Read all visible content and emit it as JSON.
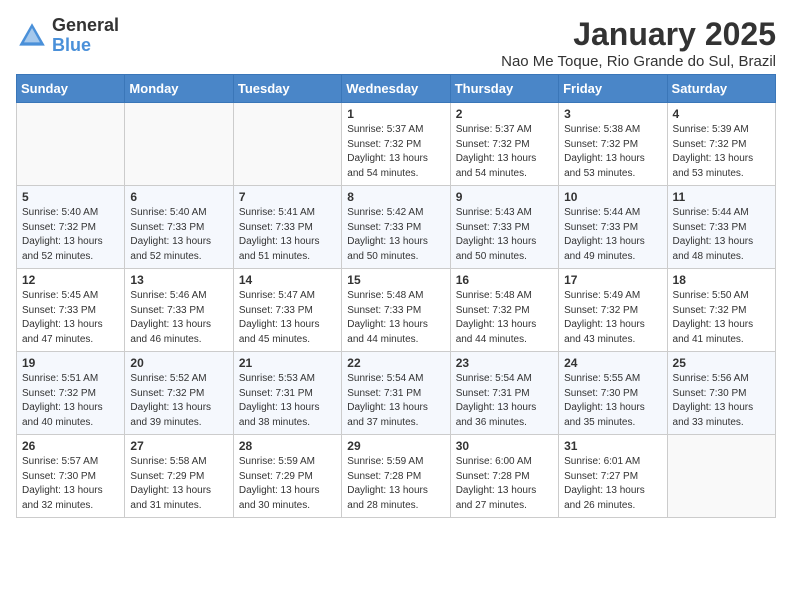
{
  "header": {
    "logo_general": "General",
    "logo_blue": "Blue",
    "month_title": "January 2025",
    "location": "Nao Me Toque, Rio Grande do Sul, Brazil"
  },
  "days_of_week": [
    "Sunday",
    "Monday",
    "Tuesday",
    "Wednesday",
    "Thursday",
    "Friday",
    "Saturday"
  ],
  "weeks": [
    [
      {
        "day": "",
        "sunrise": "",
        "sunset": "",
        "daylight": ""
      },
      {
        "day": "",
        "sunrise": "",
        "sunset": "",
        "daylight": ""
      },
      {
        "day": "",
        "sunrise": "",
        "sunset": "",
        "daylight": ""
      },
      {
        "day": "1",
        "sunrise": "Sunrise: 5:37 AM",
        "sunset": "Sunset: 7:32 PM",
        "daylight": "Daylight: 13 hours and 54 minutes."
      },
      {
        "day": "2",
        "sunrise": "Sunrise: 5:37 AM",
        "sunset": "Sunset: 7:32 PM",
        "daylight": "Daylight: 13 hours and 54 minutes."
      },
      {
        "day": "3",
        "sunrise": "Sunrise: 5:38 AM",
        "sunset": "Sunset: 7:32 PM",
        "daylight": "Daylight: 13 hours and 53 minutes."
      },
      {
        "day": "4",
        "sunrise": "Sunrise: 5:39 AM",
        "sunset": "Sunset: 7:32 PM",
        "daylight": "Daylight: 13 hours and 53 minutes."
      }
    ],
    [
      {
        "day": "5",
        "sunrise": "Sunrise: 5:40 AM",
        "sunset": "Sunset: 7:32 PM",
        "daylight": "Daylight: 13 hours and 52 minutes."
      },
      {
        "day": "6",
        "sunrise": "Sunrise: 5:40 AM",
        "sunset": "Sunset: 7:33 PM",
        "daylight": "Daylight: 13 hours and 52 minutes."
      },
      {
        "day": "7",
        "sunrise": "Sunrise: 5:41 AM",
        "sunset": "Sunset: 7:33 PM",
        "daylight": "Daylight: 13 hours and 51 minutes."
      },
      {
        "day": "8",
        "sunrise": "Sunrise: 5:42 AM",
        "sunset": "Sunset: 7:33 PM",
        "daylight": "Daylight: 13 hours and 50 minutes."
      },
      {
        "day": "9",
        "sunrise": "Sunrise: 5:43 AM",
        "sunset": "Sunset: 7:33 PM",
        "daylight": "Daylight: 13 hours and 50 minutes."
      },
      {
        "day": "10",
        "sunrise": "Sunrise: 5:44 AM",
        "sunset": "Sunset: 7:33 PM",
        "daylight": "Daylight: 13 hours and 49 minutes."
      },
      {
        "day": "11",
        "sunrise": "Sunrise: 5:44 AM",
        "sunset": "Sunset: 7:33 PM",
        "daylight": "Daylight: 13 hours and 48 minutes."
      }
    ],
    [
      {
        "day": "12",
        "sunrise": "Sunrise: 5:45 AM",
        "sunset": "Sunset: 7:33 PM",
        "daylight": "Daylight: 13 hours and 47 minutes."
      },
      {
        "day": "13",
        "sunrise": "Sunrise: 5:46 AM",
        "sunset": "Sunset: 7:33 PM",
        "daylight": "Daylight: 13 hours and 46 minutes."
      },
      {
        "day": "14",
        "sunrise": "Sunrise: 5:47 AM",
        "sunset": "Sunset: 7:33 PM",
        "daylight": "Daylight: 13 hours and 45 minutes."
      },
      {
        "day": "15",
        "sunrise": "Sunrise: 5:48 AM",
        "sunset": "Sunset: 7:33 PM",
        "daylight": "Daylight: 13 hours and 44 minutes."
      },
      {
        "day": "16",
        "sunrise": "Sunrise: 5:48 AM",
        "sunset": "Sunset: 7:32 PM",
        "daylight": "Daylight: 13 hours and 44 minutes."
      },
      {
        "day": "17",
        "sunrise": "Sunrise: 5:49 AM",
        "sunset": "Sunset: 7:32 PM",
        "daylight": "Daylight: 13 hours and 43 minutes."
      },
      {
        "day": "18",
        "sunrise": "Sunrise: 5:50 AM",
        "sunset": "Sunset: 7:32 PM",
        "daylight": "Daylight: 13 hours and 41 minutes."
      }
    ],
    [
      {
        "day": "19",
        "sunrise": "Sunrise: 5:51 AM",
        "sunset": "Sunset: 7:32 PM",
        "daylight": "Daylight: 13 hours and 40 minutes."
      },
      {
        "day": "20",
        "sunrise": "Sunrise: 5:52 AM",
        "sunset": "Sunset: 7:32 PM",
        "daylight": "Daylight: 13 hours and 39 minutes."
      },
      {
        "day": "21",
        "sunrise": "Sunrise: 5:53 AM",
        "sunset": "Sunset: 7:31 PM",
        "daylight": "Daylight: 13 hours and 38 minutes."
      },
      {
        "day": "22",
        "sunrise": "Sunrise: 5:54 AM",
        "sunset": "Sunset: 7:31 PM",
        "daylight": "Daylight: 13 hours and 37 minutes."
      },
      {
        "day": "23",
        "sunrise": "Sunrise: 5:54 AM",
        "sunset": "Sunset: 7:31 PM",
        "daylight": "Daylight: 13 hours and 36 minutes."
      },
      {
        "day": "24",
        "sunrise": "Sunrise: 5:55 AM",
        "sunset": "Sunset: 7:30 PM",
        "daylight": "Daylight: 13 hours and 35 minutes."
      },
      {
        "day": "25",
        "sunrise": "Sunrise: 5:56 AM",
        "sunset": "Sunset: 7:30 PM",
        "daylight": "Daylight: 13 hours and 33 minutes."
      }
    ],
    [
      {
        "day": "26",
        "sunrise": "Sunrise: 5:57 AM",
        "sunset": "Sunset: 7:30 PM",
        "daylight": "Daylight: 13 hours and 32 minutes."
      },
      {
        "day": "27",
        "sunrise": "Sunrise: 5:58 AM",
        "sunset": "Sunset: 7:29 PM",
        "daylight": "Daylight: 13 hours and 31 minutes."
      },
      {
        "day": "28",
        "sunrise": "Sunrise: 5:59 AM",
        "sunset": "Sunset: 7:29 PM",
        "daylight": "Daylight: 13 hours and 30 minutes."
      },
      {
        "day": "29",
        "sunrise": "Sunrise: 5:59 AM",
        "sunset": "Sunset: 7:28 PM",
        "daylight": "Daylight: 13 hours and 28 minutes."
      },
      {
        "day": "30",
        "sunrise": "Sunrise: 6:00 AM",
        "sunset": "Sunset: 7:28 PM",
        "daylight": "Daylight: 13 hours and 27 minutes."
      },
      {
        "day": "31",
        "sunrise": "Sunrise: 6:01 AM",
        "sunset": "Sunset: 7:27 PM",
        "daylight": "Daylight: 13 hours and 26 minutes."
      },
      {
        "day": "",
        "sunrise": "",
        "sunset": "",
        "daylight": ""
      }
    ]
  ]
}
